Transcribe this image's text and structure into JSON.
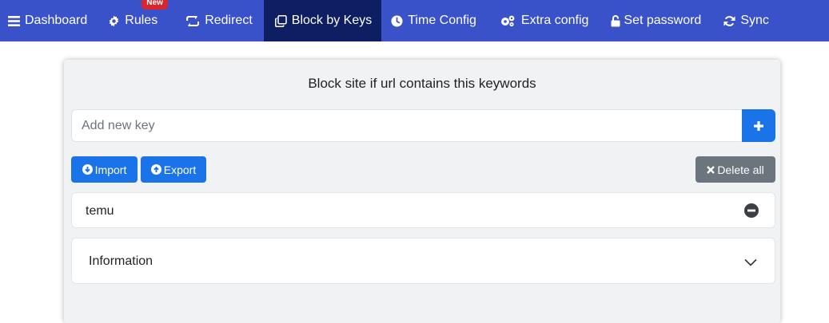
{
  "nav": {
    "items": [
      {
        "label": "Dashboard",
        "icon": "menu-icon"
      },
      {
        "label": "Rules",
        "icon": "gear-icon",
        "badge": "New"
      },
      {
        "label": "Redirect",
        "icon": "retweet-icon"
      },
      {
        "label": "Block by Keys",
        "icon": "copy-icon",
        "active": true
      },
      {
        "label": "Time Config",
        "icon": "clock-icon"
      },
      {
        "label": "Extra config",
        "icon": "cogs-icon"
      },
      {
        "label": "Set password",
        "icon": "unlock-icon"
      },
      {
        "label": "Sync",
        "icon": "refresh-icon"
      }
    ]
  },
  "panel": {
    "title": "Block site if url contains this keywords",
    "input": {
      "placeholder": "Add new key",
      "value": ""
    },
    "buttons": {
      "import": "Import",
      "export": "Export",
      "delete_all": "Delete all"
    },
    "keys": [
      "temu"
    ],
    "info_label": "Information"
  },
  "colors": {
    "navbar": "#3a52c9",
    "nav_active": "#0e1e63",
    "primary": "#1a73e8",
    "secondary": "#6c757d",
    "badge": "#d9262d"
  }
}
